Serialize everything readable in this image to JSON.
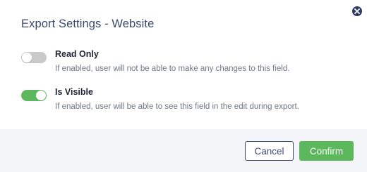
{
  "dialog": {
    "title": "Export Settings - Website",
    "close_icon": "close-circle-icon"
  },
  "settings": [
    {
      "label": "Read Only",
      "description": "If enabled, user will not be able to make any changes to this field.",
      "enabled": false
    },
    {
      "label": "Is Visible",
      "description": "If enabled, user will be able to see this field in the edit during export.",
      "enabled": true
    }
  ],
  "footer": {
    "cancel_label": "Cancel",
    "confirm_label": "Confirm"
  },
  "colors": {
    "title": "#3a4a6e",
    "toggle_on": "#5cb85c",
    "toggle_off": "#c9c9c9",
    "confirm_bg": "#5cb85c",
    "cancel_border": "#3f4a78",
    "footer_bg": "#f4f5f8"
  }
}
